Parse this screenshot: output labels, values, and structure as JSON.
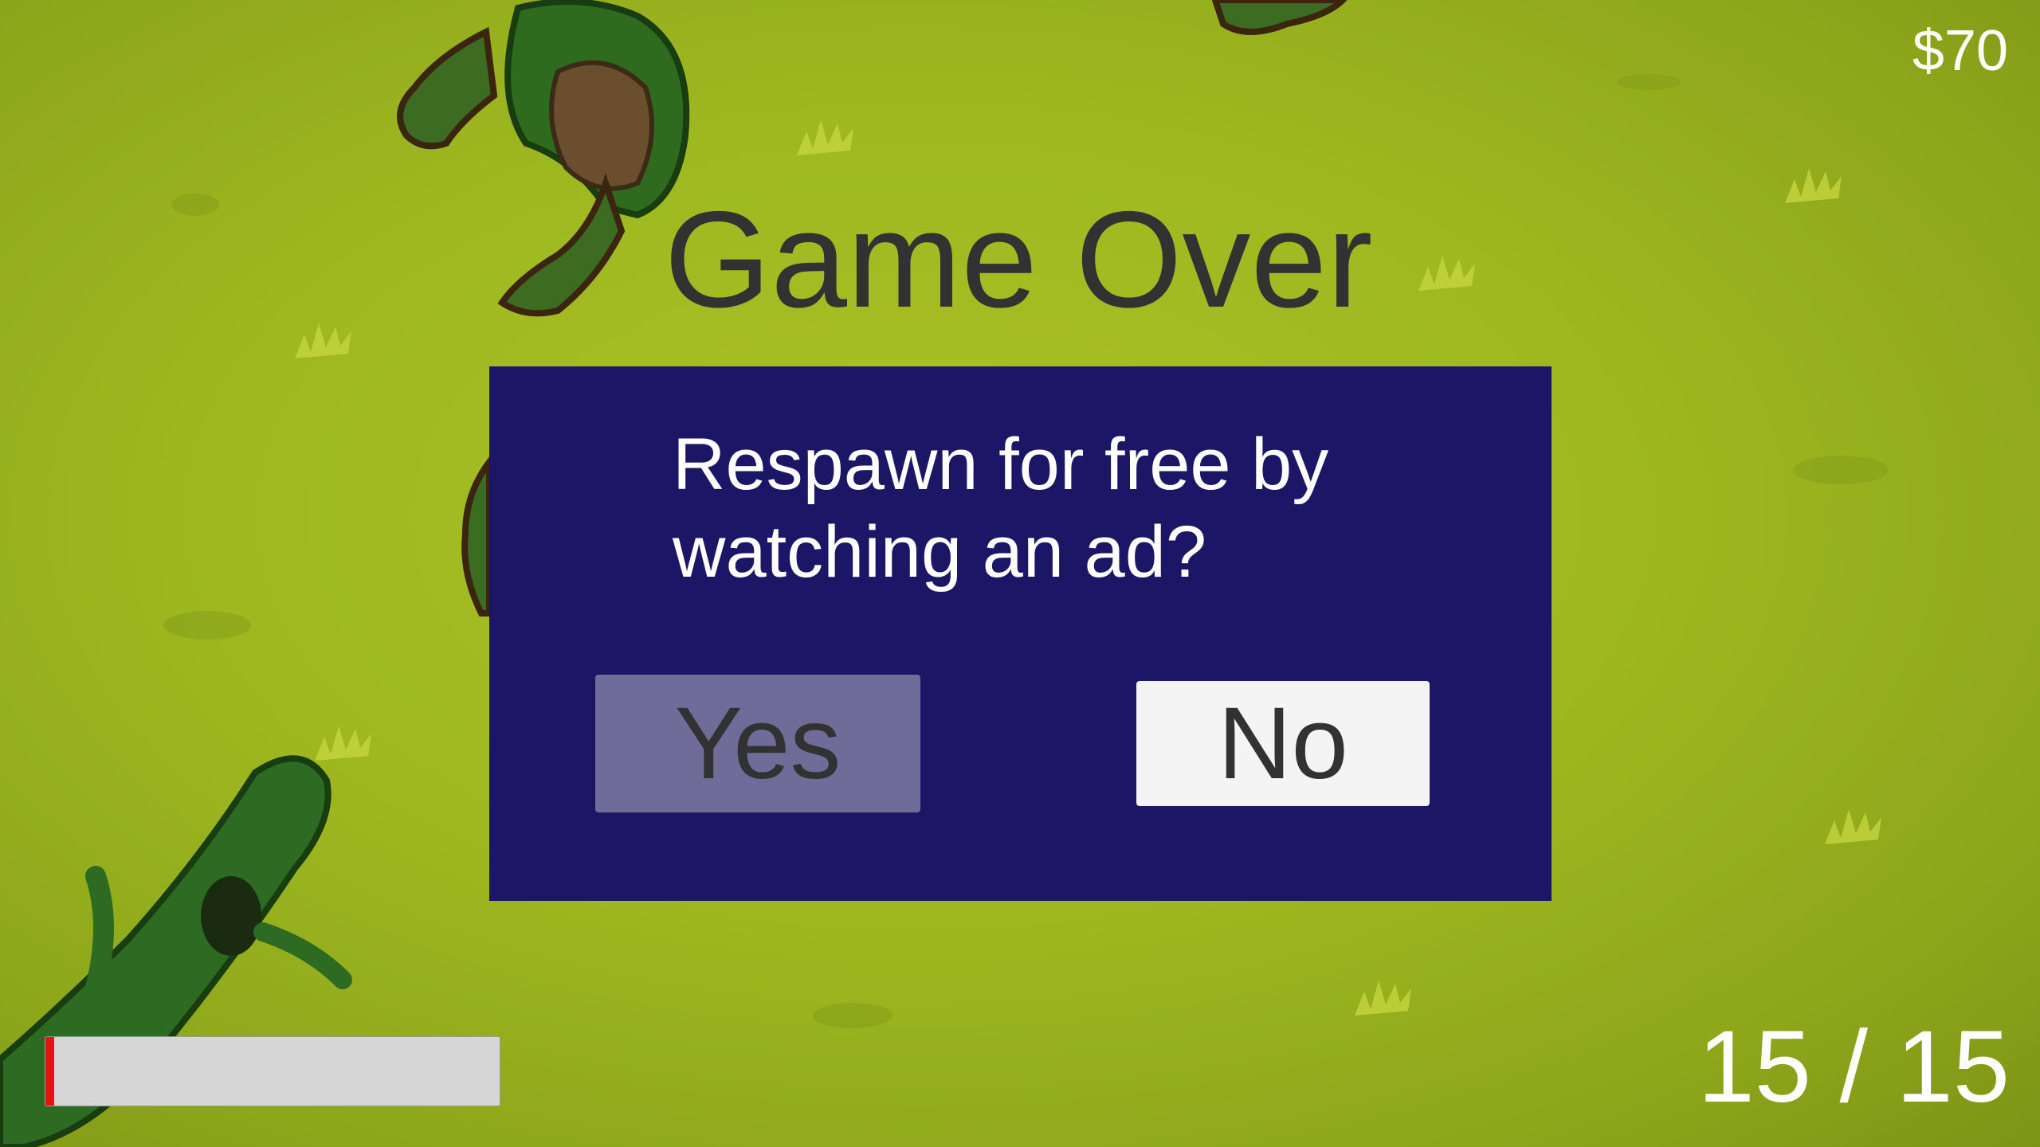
{
  "hud": {
    "money": "$70",
    "ammo": "15 / 15",
    "health_fraction": 0.02,
    "health_color": "#e8140f"
  },
  "title": "Game Over",
  "dialog": {
    "prompt": "Respawn for free by watching an ad?",
    "yes_label": "Yes",
    "no_label": "No",
    "background": "#1b1766"
  },
  "sprites": [
    "zombie-top",
    "zombie-right",
    "zombie-left",
    "zombie-bottom-left",
    "grass-tufts"
  ]
}
